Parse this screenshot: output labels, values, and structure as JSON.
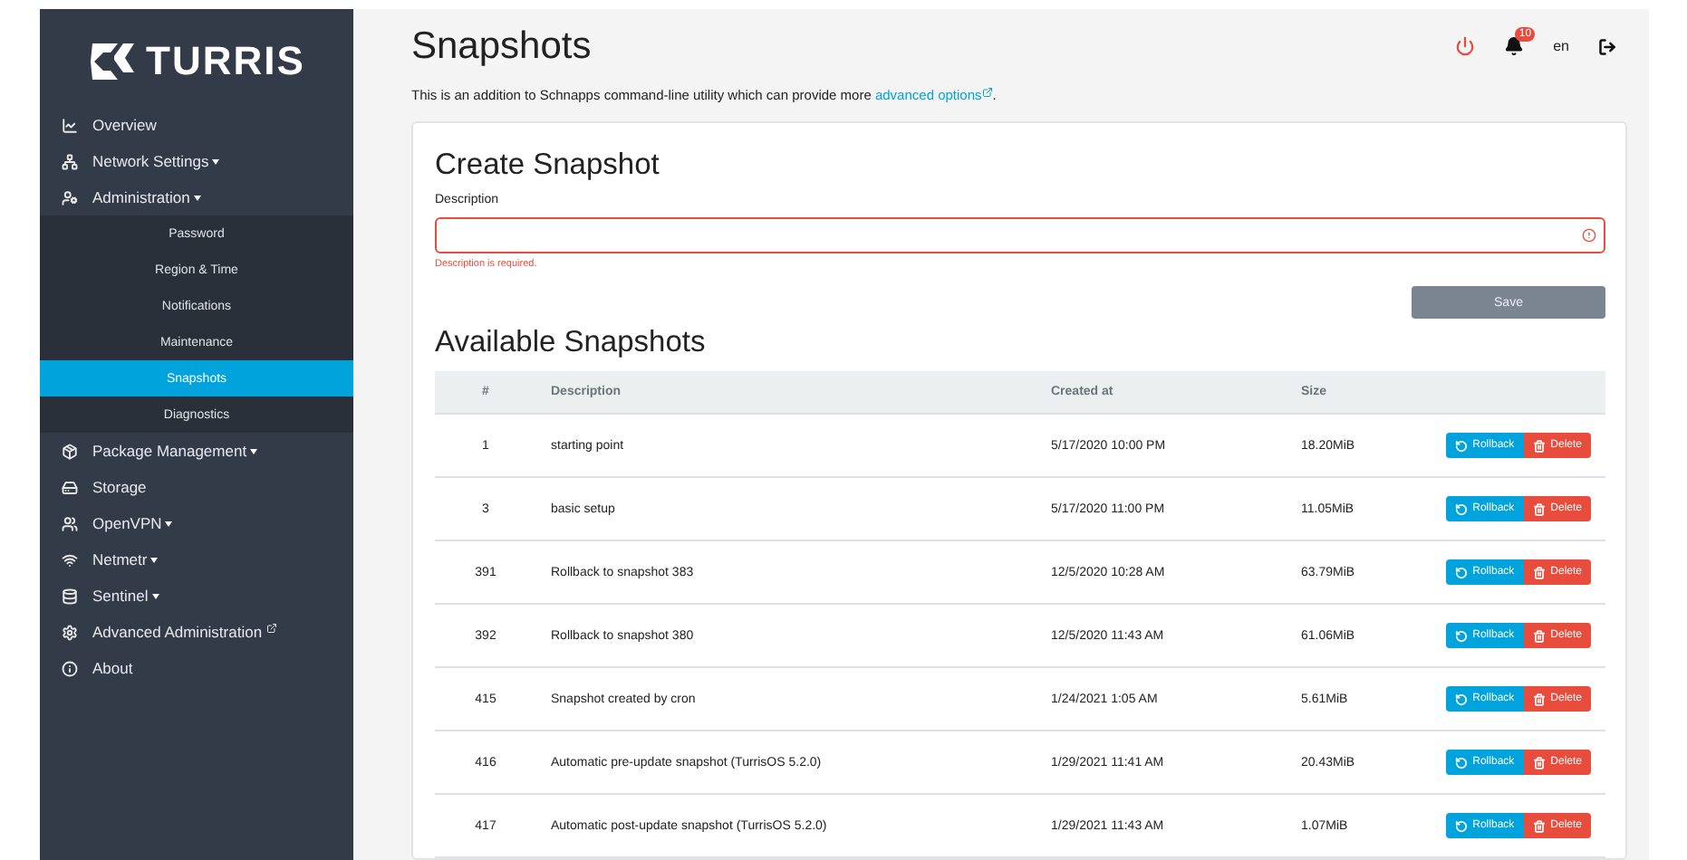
{
  "brand": {
    "name": "TURRIS"
  },
  "sidebar": {
    "items": [
      {
        "label": "Overview",
        "dropdown": false,
        "external": false
      },
      {
        "label": "Network Settings",
        "dropdown": true,
        "external": false
      },
      {
        "label": "Administration",
        "dropdown": true,
        "external": false,
        "expanded": true,
        "children": [
          {
            "label": "Password",
            "selected": false
          },
          {
            "label": "Region & Time",
            "selected": false
          },
          {
            "label": "Notifications",
            "selected": false
          },
          {
            "label": "Maintenance",
            "selected": false
          },
          {
            "label": "Snapshots",
            "selected": true
          },
          {
            "label": "Diagnostics",
            "selected": false
          }
        ]
      },
      {
        "label": "Package Management",
        "dropdown": true,
        "external": false
      },
      {
        "label": "Storage",
        "dropdown": false,
        "external": false
      },
      {
        "label": "OpenVPN",
        "dropdown": true,
        "external": false
      },
      {
        "label": "Netmetr",
        "dropdown": true,
        "external": false
      },
      {
        "label": "Sentinel",
        "dropdown": true,
        "external": false
      },
      {
        "label": "Advanced Administration",
        "dropdown": false,
        "external": true
      },
      {
        "label": "About",
        "dropdown": false,
        "external": false
      }
    ]
  },
  "header": {
    "title": "Snapshots",
    "notification_count": "10",
    "language": "en"
  },
  "intro": {
    "text": "This is an addition to Schnapps command-line utility which can provide more ",
    "link": "advanced options",
    "end": "."
  },
  "create": {
    "title": "Create Snapshot",
    "label": "Description",
    "error": "Description is required.",
    "save": "Save"
  },
  "snapshots": {
    "title": "Available Snapshots",
    "columns": [
      "#",
      "Description",
      "Created at",
      "Size"
    ],
    "rows": [
      {
        "number": "1",
        "description": "starting point",
        "created": "5/17/2020 10:00 PM",
        "size": "18.20MiB",
        "rollback": "Rollback",
        "delete": "Delete"
      },
      {
        "number": "3",
        "description": "basic setup",
        "created": "5/17/2020 11:00 PM",
        "size": "11.05MiB",
        "rollback": "Rollback",
        "delete": "Delete"
      },
      {
        "number": "391",
        "description": "Rollback to snapshot 383",
        "created": "12/5/2020 10:28 AM",
        "size": "63.79MiB",
        "rollback": "Rollback",
        "delete": "Delete"
      },
      {
        "number": "392",
        "description": "Rollback to snapshot 380",
        "created": "12/5/2020 11:43 AM",
        "size": "61.06MiB",
        "rollback": "Rollback",
        "delete": "Delete"
      },
      {
        "number": "415",
        "description": "Snapshot created by cron",
        "created": "1/24/2021 1:05 AM",
        "size": "5.61MiB",
        "rollback": "Rollback",
        "delete": "Delete"
      },
      {
        "number": "416",
        "description": "Automatic pre-update snapshot (TurrisOS 5.2.0)",
        "created": "1/29/2021 11:41 AM",
        "size": "20.43MiB",
        "rollback": "Rollback",
        "delete": "Delete"
      },
      {
        "number": "417",
        "description": "Automatic post-update snapshot (TurrisOS 5.2.0)",
        "created": "1/29/2021 11:43 AM",
        "size": "1.07MiB",
        "rollback": "Rollback",
        "delete": "Delete"
      }
    ]
  }
}
